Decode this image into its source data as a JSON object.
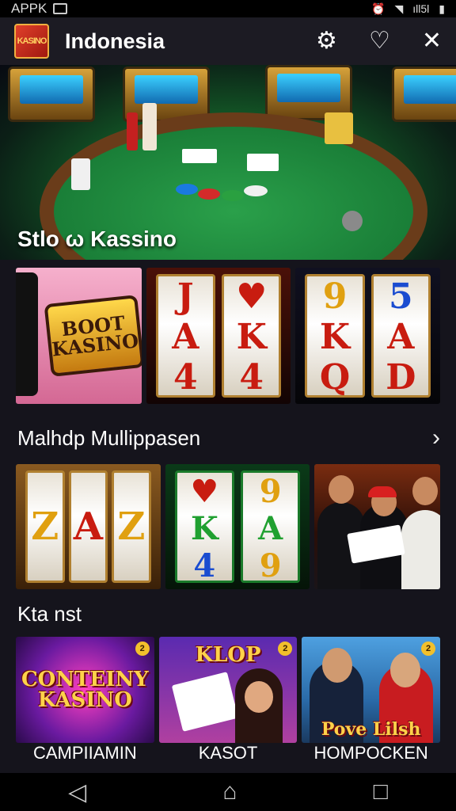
{
  "status_bar": {
    "left_label": "APPK",
    "right_label": "ıll5l"
  },
  "app_bar": {
    "logo_text": "KASINO",
    "title": "Indonesia",
    "icons": [
      "gear-icon",
      "heart-icon",
      "tools-icon"
    ]
  },
  "hero": {
    "title": "Stlo ω Kassino"
  },
  "row1": {
    "tile1_badge": "BOOT KASINO",
    "tile2_reels": [
      [
        "J",
        "A",
        "4"
      ],
      [
        "♥",
        "K",
        "4"
      ]
    ],
    "tile3_reels": [
      [
        "9",
        "K",
        "Q"
      ],
      [
        "5",
        "A",
        "D"
      ]
    ]
  },
  "section2": {
    "title": "Malhdp Mullippasen",
    "chevron": "›"
  },
  "row2": {
    "tile1_reels": [
      [
        "Z"
      ],
      [
        "A"
      ],
      [
        "Z"
      ]
    ],
    "tile2_reels": [
      [
        "♥",
        "K",
        "4"
      ],
      [
        "9",
        "A",
        "9"
      ]
    ]
  },
  "section3": {
    "title": "Kta nst"
  },
  "promos": [
    {
      "logo": "CONTEINY KASINO",
      "caption": "CAMPIIAMIN"
    },
    {
      "logo": "KLOP",
      "caption": "KASOT"
    },
    {
      "logo": "Pove Lilsh",
      "caption": "HOMPOCKEN"
    }
  ],
  "nav": {
    "back": "◁",
    "home": "⌂",
    "recent": "□"
  },
  "colors": {
    "app_bar": "#1c1b23",
    "background": "#15141c",
    "accent_gold": "#ffd24a",
    "felt_green": "#1d7a36"
  }
}
